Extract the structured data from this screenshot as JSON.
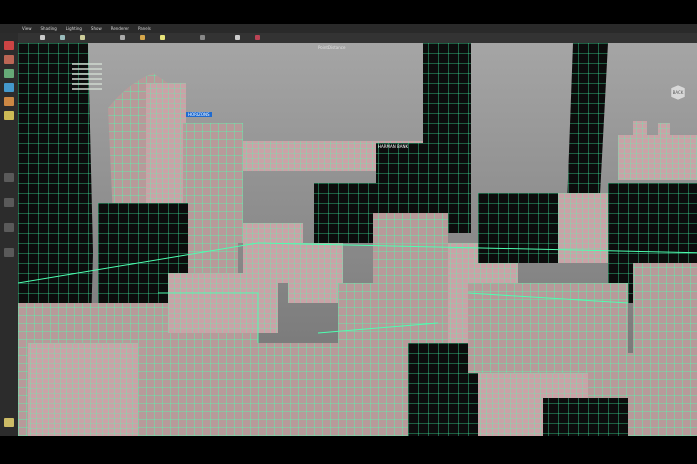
{
  "menu": [
    "View",
    "Shading",
    "Lighting",
    "Show",
    "Renderer",
    "Panels"
  ],
  "viewport": {
    "panel_label": "PointDistance",
    "viewcube_label": "BACK"
  },
  "signs": {
    "harman_bank": "HARMAN BANK",
    "rooftop_sign": "HORIZONS"
  },
  "colors": {
    "wireframe": "#4dffb0",
    "sky": "#8a8a8a",
    "building_fill": "#b79a9a",
    "dark_tower": "#0c0c0c"
  },
  "icons": [
    "select-tool-icon",
    "lasso-icon",
    "paint-icon",
    "move-icon",
    "rotate-icon",
    "scale-icon",
    "layout-icon"
  ]
}
